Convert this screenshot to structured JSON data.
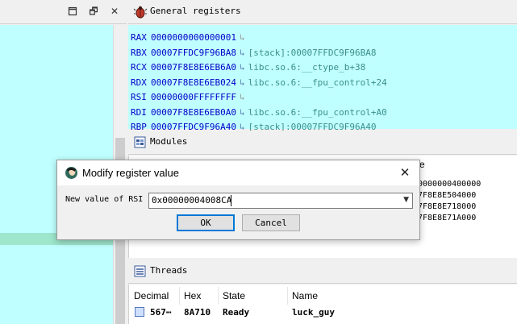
{
  "left_panel": {
    "restore_glyph": "🗗",
    "close_glyph": "✕"
  },
  "registers": {
    "title": "General registers",
    "rows": [
      {
        "name": "RAX",
        "value": "0000000000000001",
        "arrow": "↳",
        "desc": "",
        "arrow_color": "grey"
      },
      {
        "name": "RBX",
        "value": "00007FFDC9F96BA8",
        "arrow": "↳",
        "desc": "[stack]:00007FFDC9F96BA8",
        "arrow_color": "blue"
      },
      {
        "name": "RCX",
        "value": "00007F8E8E6EB6A0",
        "arrow": "↳",
        "desc": "libc.so.6:__ctype_b+38",
        "arrow_color": "blue"
      },
      {
        "name": "RDX",
        "value": "00007F8E8E6EB024",
        "arrow": "↳",
        "desc": "libc.so.6:__fpu_control+24",
        "arrow_color": "blue"
      },
      {
        "name": "RSI",
        "value": "00000000FFFFFFFF",
        "arrow": "↳",
        "desc": "",
        "arrow_color": "grey"
      },
      {
        "name": "RDI",
        "value": "00007F8E8E6EB0A0",
        "arrow": "↳",
        "desc": "libc.so.6:__fpu_control+A0",
        "arrow_color": "blue"
      },
      {
        "name": "RBP",
        "value": "00007FFDC9F96A40",
        "arrow": "↳",
        "desc": "[stack]:00007FFDC9F96A40",
        "arrow_color": "blue"
      }
    ]
  },
  "modules": {
    "title": "Modules",
    "header_partial": "e",
    "rows": [
      "0000000400000",
      "7F8E8E504000",
      "7F8E8E718000",
      "7F8E8E71A000"
    ]
  },
  "threads": {
    "title": "Threads",
    "columns": [
      "Decimal",
      "Hex",
      "State",
      "Name"
    ],
    "rows": [
      {
        "decimal": "567⋯",
        "hex": "8A710",
        "state": "Ready",
        "name": "luck_guy"
      }
    ]
  },
  "dialog": {
    "title": "Modify register value",
    "close_glyph": "✕",
    "label": "New value of RSI",
    "value": "0x00000004008CA",
    "dropdown_glyph": "▼",
    "ok_label": "OK",
    "cancel_label": "Cancel"
  }
}
